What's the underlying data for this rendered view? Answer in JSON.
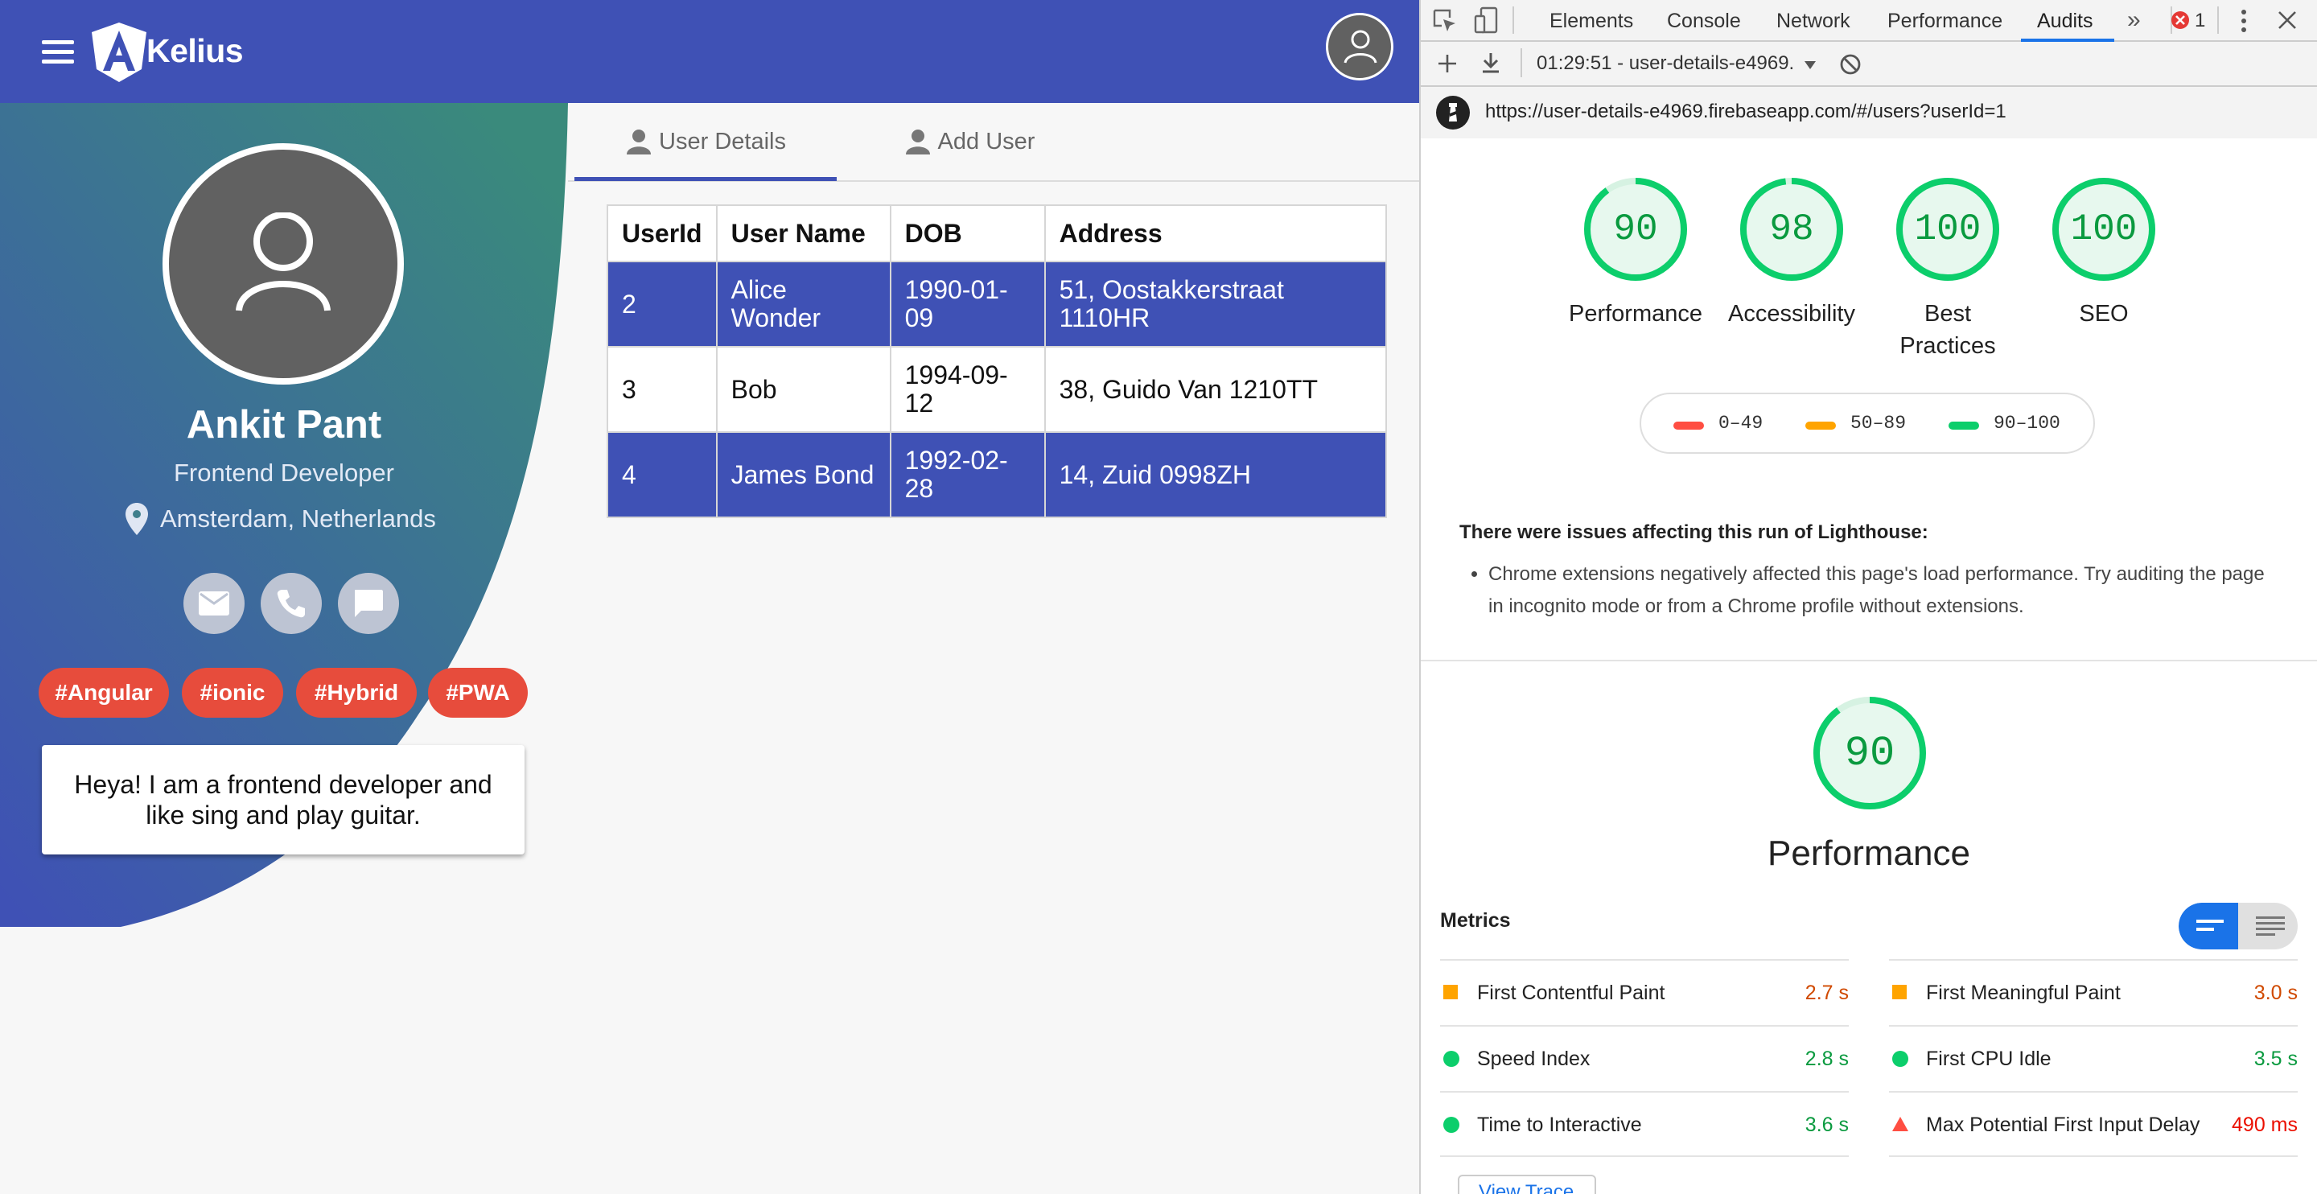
{
  "app": {
    "brand": "Kelius",
    "profile": {
      "name": "Ankit Pant",
      "role": "Frontend Developer",
      "location": "Amsterdam, Netherlands",
      "tags": [
        "#Angular",
        "#ionic",
        "#Hybrid",
        "#PWA"
      ],
      "bio": "Heya! I am a frontend developer and like sing and play guitar."
    },
    "tabs": [
      {
        "label": "User Details",
        "active": true
      },
      {
        "label": "Add User",
        "active": false
      }
    ],
    "table": {
      "headers": [
        "UserId",
        "User Name",
        "DOB",
        "Address"
      ],
      "rows": [
        {
          "id": "2",
          "name": "Alice Wonder",
          "dob": "1990-01-09",
          "address": "51, Oostakkerstraat 1110HR"
        },
        {
          "id": "3",
          "name": "Bob",
          "dob": "1994-09-12",
          "address": "38, Guido Van 1210TT"
        },
        {
          "id": "4",
          "name": "James Bond",
          "dob": "1992-02-28",
          "address": "14, Zuid 0998ZH"
        }
      ]
    },
    "colors": {
      "primary": "#3f51b5",
      "tag": "#e74c3c",
      "gradient_start": "#3a8a7c",
      "gradient_end": "#3f51b5"
    }
  },
  "devtools": {
    "tabs": [
      "Elements",
      "Console",
      "Network",
      "Performance",
      "Audits"
    ],
    "active_tab": "Audits",
    "overflow": "»",
    "error_count": "1",
    "report_select": "01:29:51 - user-details-e4969.",
    "url": "https://user-details-e4969.firebaseapp.com/#/users?userId=1",
    "scores": [
      {
        "value": "90",
        "label": "Performance"
      },
      {
        "value": "98",
        "label": "Accessibility"
      },
      {
        "value": "100",
        "label": "Best Practices"
      },
      {
        "value": "100",
        "label": "SEO"
      }
    ],
    "legend": [
      {
        "range": "0–49",
        "color": "#ff4e42"
      },
      {
        "range": "50–89",
        "color": "#ffa400"
      },
      {
        "range": "90–100",
        "color": "#0cce6b"
      }
    ],
    "warning_title": "There were issues affecting this run of Lighthouse:",
    "warning_item": "Chrome extensions negatively affected this page's load performance. Try auditing the page in incognito mode or from a Chrome profile without extensions.",
    "perf_score": "90",
    "perf_title": "Performance",
    "metrics_title": "Metrics",
    "metrics": [
      {
        "name": "First Contentful Paint",
        "value": "2.7 s",
        "status": "average"
      },
      {
        "name": "First Meaningful Paint",
        "value": "3.0 s",
        "status": "average"
      },
      {
        "name": "Speed Index",
        "value": "2.8 s",
        "status": "pass"
      },
      {
        "name": "First CPU Idle",
        "value": "3.5 s",
        "status": "pass"
      },
      {
        "name": "Time to Interactive",
        "value": "3.6 s",
        "status": "pass"
      },
      {
        "name": "Max Potential First Input Delay",
        "value": "490 ms",
        "status": "fail"
      }
    ],
    "view_trace": "View Trace",
    "status_colors": {
      "pass": "#0a9a3f",
      "average": "#d04900",
      "fail": "#eb0f00"
    }
  }
}
